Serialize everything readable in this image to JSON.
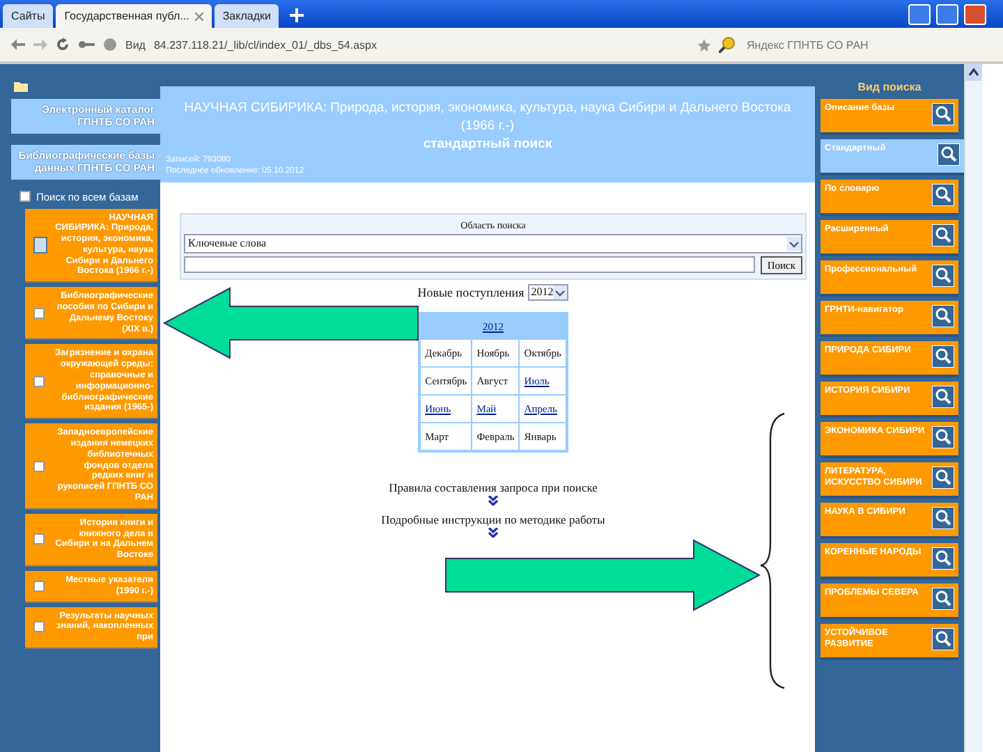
{
  "browser": {
    "tabs": [
      {
        "label": "Сайты",
        "selected": false
      },
      {
        "label": "Государственная публ...",
        "selected": true
      },
      {
        "label": "Закладки",
        "selected": false
      }
    ],
    "back_label": "Вид",
    "address": "84.237.118.21/_lib/cl/index_01/_dbs_54.aspx",
    "search_placeholder": "Яндекс ГПНТБ СО РАН"
  },
  "left": {
    "catalogs": [
      {
        "label": "Электронный каталог ГПНТБ СО РАН"
      },
      {
        "label": "Библиографические базы данных ГПНТБ СО РАН"
      }
    ],
    "all_bases": {
      "label": "Поиск по всем базам",
      "checked": false
    },
    "bases": [
      {
        "label": "НАУЧНАЯ СИБИРИКА: Природа, история, экономика, культура, наука Сибири и Дальнего Востока (1966 г.-)",
        "checked": true
      },
      {
        "label": "Библиографические пособия по Сибири и Дальнему Востоку (XIX в.)",
        "checked": false
      },
      {
        "label": "Загрязнение и охрана окружающей среды: справочные и информационно-библиографические издания (1965-)",
        "checked": false
      },
      {
        "label": "Западноевропейские издания немецких библиотечных фондов отдела редких книг и рукописей ГПНТБ СО РАН",
        "checked": false
      },
      {
        "label": "История книги и книжного дела в Сибири и на Дальнем Востоке",
        "checked": false
      },
      {
        "label": "Местные указатели (1990 г.-)",
        "checked": false
      },
      {
        "label": "Результаты научных знаний, накопленных при",
        "checked": false
      }
    ]
  },
  "header": {
    "title": "НАУЧНАЯ СИБИРИКА: Природа, история, экономика, культура, наука Сибири и Дальнего Востока (1966 г.-)",
    "subtitle": "стандартный поиск",
    "records": "Записей: 793080",
    "updated": "Последнее обновление: 05.10.2012"
  },
  "search": {
    "area_label": "Область поиска",
    "area": "Ключевые слова",
    "button": "Поиск"
  },
  "new_arrivals": {
    "label": "Новые поступления",
    "year": "2012",
    "table_year": "2012",
    "months": [
      {
        "label": "Декабрь",
        "link": false
      },
      {
        "label": "Ноябрь",
        "link": false
      },
      {
        "label": "Октябрь",
        "link": false
      },
      {
        "label": "Сентябрь",
        "link": false
      },
      {
        "label": "Август",
        "link": false
      },
      {
        "label": "Июль",
        "link": true
      },
      {
        "label": "Июнь",
        "link": true
      },
      {
        "label": "Май",
        "link": true
      },
      {
        "label": "Апрель",
        "link": true
      },
      {
        "label": "Март",
        "link": false
      },
      {
        "label": "Февраль",
        "link": false
      },
      {
        "label": "Январь",
        "link": false
      }
    ]
  },
  "help": [
    "Правила составления запроса при поиске",
    "Подробные инструкции по методике работы"
  ],
  "right": {
    "title": "Вид поиска",
    "items": [
      {
        "label": "Описание базы",
        "selected": false
      },
      {
        "label": "Стандартный",
        "selected": true
      },
      {
        "label": "По словарю",
        "selected": false
      },
      {
        "label": "Расширенный",
        "selected": false
      },
      {
        "label": "Профессиональный",
        "selected": false
      },
      {
        "label": "ГРНТИ-навигатор",
        "selected": false
      },
      {
        "label": "ПРИРОДА СИБИРИ",
        "selected": false
      },
      {
        "label": "ИСТОРИЯ СИБИРИ",
        "selected": false
      },
      {
        "label": "ЭКОНОМИКА СИБИРИ",
        "selected": false
      },
      {
        "label": "ЛИТЕРАТУРА, ИСКУССТВО СИБИРИ",
        "selected": false
      },
      {
        "label": "НАУКА В СИБИРИ",
        "selected": false
      },
      {
        "label": "КОРЕННЫЕ НАРОДЫ",
        "selected": false
      },
      {
        "label": "ПРОБЛЕМЫ СЕВЕРА",
        "selected": false
      },
      {
        "label": "УСТОЙЧИВОЕ РАЗВИТИЕ",
        "selected": false
      }
    ]
  }
}
